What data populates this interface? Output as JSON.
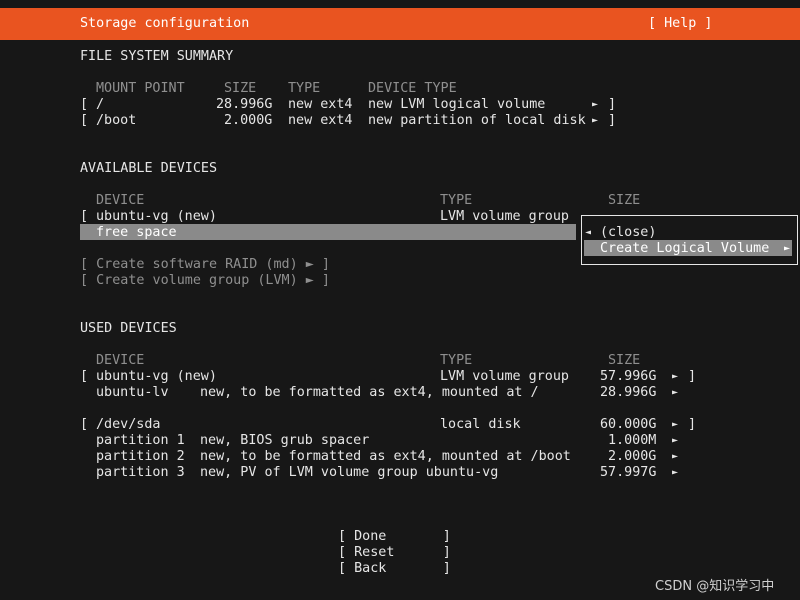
{
  "header": {
    "title": "Storage configuration",
    "help": "[ Help ]"
  },
  "fs_summary": {
    "heading": "FILE SYSTEM SUMMARY",
    "columns": {
      "mount": "MOUNT POINT",
      "size": "SIZE",
      "type": "TYPE",
      "device_type": "DEVICE TYPE"
    },
    "rows": [
      {
        "bracket_open": "[",
        "mount": "/",
        "size": "28.996G",
        "type": "new ext4",
        "device_type": "new LVM logical volume",
        "arrow": "►",
        "bracket_close": "]"
      },
      {
        "bracket_open": "[",
        "mount": "/boot",
        "size": "2.000G",
        "type": "new ext4",
        "device_type": "new partition of local disk",
        "arrow": "►",
        "bracket_close": "]"
      }
    ]
  },
  "available": {
    "heading": "AVAILABLE DEVICES",
    "columns": {
      "device": "DEVICE",
      "type": "TYPE",
      "size": "SIZE"
    },
    "rows": [
      {
        "bracket_open": "[",
        "device": "ubuntu-vg (new)",
        "type": "LVM volume group"
      },
      {
        "device": "free space"
      }
    ],
    "actions": [
      "[ Create software RAID (md) ► ]",
      "[ Create volume group (LVM) ► ]"
    ]
  },
  "popup": {
    "left_arrow": "◄",
    "items": [
      {
        "label": "(close)"
      },
      {
        "label": "Create Logical Volume",
        "arrow": "►"
      }
    ]
  },
  "used": {
    "heading": "USED DEVICES",
    "columns": {
      "device": "DEVICE",
      "type": "TYPE",
      "size": "SIZE"
    },
    "rows": [
      {
        "bracket_open": "[",
        "device": "ubuntu-vg (new)",
        "detail": "",
        "type": "LVM volume group",
        "size": "57.996G",
        "arrow": "►",
        "bracket_close": "]"
      },
      {
        "bracket_open": "",
        "device": "ubuntu-lv",
        "detail": "new, to be formatted as ext4, mounted at /",
        "type": "",
        "size": "28.996G",
        "arrow": "►",
        "bracket_close": ""
      },
      {
        "bracket_open": "[",
        "device": "/dev/sda",
        "detail": "",
        "type": "local disk",
        "size": "60.000G",
        "arrow": "►",
        "bracket_close": "]"
      },
      {
        "bracket_open": "",
        "device": "partition 1",
        "detail": "new, BIOS grub spacer",
        "type": "",
        "size": "1.000M",
        "arrow": "►",
        "bracket_close": ""
      },
      {
        "bracket_open": "",
        "device": "partition 2",
        "detail": "new, to be formatted as ext4, mounted at /boot",
        "type": "",
        "size": "2.000G",
        "arrow": "►",
        "bracket_close": ""
      },
      {
        "bracket_open": "",
        "device": "partition 3",
        "detail": "new, PV of LVM volume group ubuntu-vg",
        "type": "",
        "size": "57.997G",
        "arrow": "►",
        "bracket_close": ""
      }
    ]
  },
  "buttons": [
    {
      "label": "[ Done       ]"
    },
    {
      "label": "[ Reset      ]"
    },
    {
      "label": "[ Back       ]"
    }
  ],
  "watermark": "CSDN @知识学习中",
  "colors": {
    "accent": "#e95420",
    "background": "#171717",
    "highlight": "#8a8a8a",
    "text": "#e6e6e6"
  }
}
